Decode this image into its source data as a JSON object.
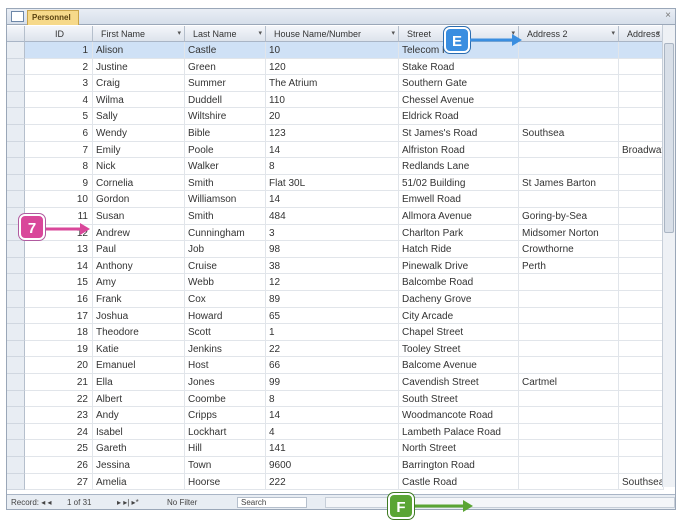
{
  "tab": {
    "title": "Personnel",
    "close": "×"
  },
  "columns": [
    "ID",
    "First Name",
    "Last Name",
    "House Name/Number",
    "Street",
    "Address 2",
    "Address"
  ],
  "rows": [
    [
      "1",
      "Alison",
      "Castle",
      "10",
      "Telecom Road",
      "",
      ""
    ],
    [
      "2",
      "Justine",
      "Green",
      "120",
      "Stake Road",
      "",
      ""
    ],
    [
      "3",
      "Craig",
      "Summer",
      "The Atrium",
      "Southern Gate",
      "",
      ""
    ],
    [
      "4",
      "Wilma",
      "Duddell",
      "110",
      "Chessel Avenue",
      "",
      ""
    ],
    [
      "5",
      "Sally",
      "Wiltshire",
      "20",
      "Eldrick Road",
      "",
      ""
    ],
    [
      "6",
      "Wendy",
      "Bible",
      "123",
      "St James's Road",
      "Southsea",
      ""
    ],
    [
      "7",
      "Emily",
      "Poole",
      "14",
      "Alfriston Road",
      "",
      "Broadwat"
    ],
    [
      "8",
      "Nick",
      "Walker",
      "8",
      "Redlands Lane",
      "",
      ""
    ],
    [
      "9",
      "Cornelia",
      "Smith",
      "Flat 30L",
      "51/02 Building",
      "St James Barton",
      ""
    ],
    [
      "10",
      "Gordon",
      "Williamson",
      "14",
      "Emwell Road",
      "",
      ""
    ],
    [
      "11",
      "Susan",
      "Smith",
      "484",
      "Allmora Avenue",
      "Goring-by-Sea",
      ""
    ],
    [
      "12",
      "Andrew",
      "Cunningham",
      "3",
      "Charlton Park",
      "Midsomer Norton",
      ""
    ],
    [
      "13",
      "Paul",
      "Job",
      "98",
      "Hatch Ride",
      "Crowthorne",
      ""
    ],
    [
      "14",
      "Anthony",
      "Cruise",
      "38",
      "Pinewalk Drive",
      "Perth",
      ""
    ],
    [
      "15",
      "Amy",
      "Webb",
      "12",
      "Balcombe Road",
      "",
      ""
    ],
    [
      "16",
      "Frank",
      "Cox",
      "89",
      "Dacheny Grove",
      "",
      ""
    ],
    [
      "17",
      "Joshua",
      "Howard",
      "65",
      "City Arcade",
      "",
      ""
    ],
    [
      "18",
      "Theodore",
      "Scott",
      "1",
      "Chapel Street",
      "",
      ""
    ],
    [
      "19",
      "Katie",
      "Jenkins",
      "22",
      "Tooley Street",
      "",
      ""
    ],
    [
      "20",
      "Emanuel",
      "Host",
      "66",
      "Balcome Avenue",
      "",
      ""
    ],
    [
      "21",
      "Ella",
      "Jones",
      "99",
      "Cavendish Street",
      "Cartmel",
      ""
    ],
    [
      "22",
      "Albert",
      "Coombe",
      "8",
      "South Street",
      "",
      ""
    ],
    [
      "23",
      "Andy",
      "Cripps",
      "14",
      "Woodmancote Road",
      "",
      ""
    ],
    [
      "24",
      "Isabel",
      "Lockhart",
      "4",
      "Lambeth Palace Road",
      "",
      ""
    ],
    [
      "25",
      "Gareth",
      "Hill",
      "141",
      "North Street",
      "",
      ""
    ],
    [
      "26",
      "Jessina",
      "Town",
      "9600",
      "Barrington Road",
      "",
      ""
    ],
    [
      "27",
      "Amelia",
      "Hoorse",
      "222",
      "Castle Road",
      "",
      "Southsea"
    ]
  ],
  "status": {
    "record_label": "Record: ◂ ◂",
    "record_pos": "1 of 31",
    "nav": "▸ ▸| ▸*",
    "filter": "No Filter",
    "search": "Search"
  },
  "callouts": {
    "e": "E",
    "seven": "7",
    "f": "F"
  }
}
